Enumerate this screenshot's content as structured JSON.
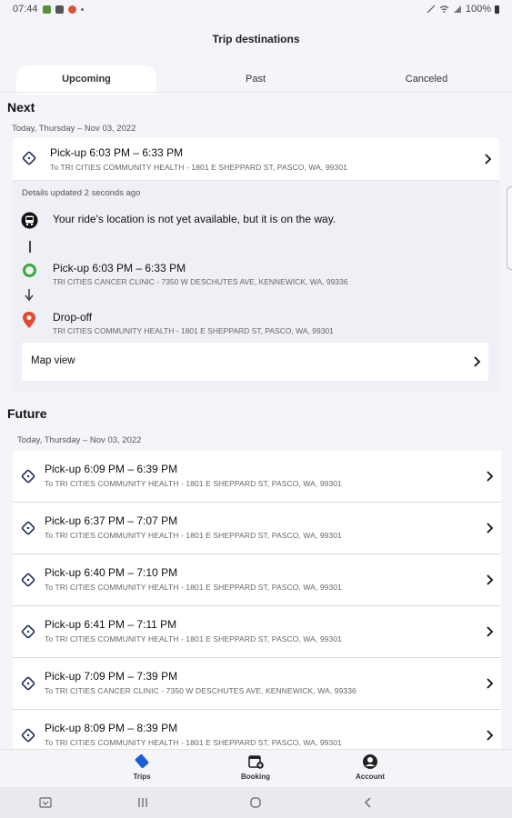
{
  "status": {
    "time": "07:44",
    "battery": "100%"
  },
  "header": {
    "title": "Trip destinations"
  },
  "tabs": [
    {
      "label": "Upcoming",
      "active": true
    },
    {
      "label": "Past",
      "active": false
    },
    {
      "label": "Canceled",
      "active": false
    }
  ],
  "next": {
    "heading": "Next",
    "date": "Today, Thursday – Nov 03, 2022",
    "trip": {
      "title": "Pick-up 6:03 PM – 6:33 PM",
      "subtitle": "To TRI CITIES COMMUNITY HEALTH - 1801 E SHEPPARD ST, PASCO, WA, 99301"
    },
    "details": {
      "updated": "Details updated 2 seconds ago",
      "message": "Your ride's location is not yet available, but it is on the way.",
      "pickup_title": "Pick-up 6:03 PM – 6:33 PM",
      "pickup_address": "TRI CITIES CANCER CLINIC - 7350 W DESCHUTES AVE, KENNEWICK, WA, 99336",
      "dropoff_title": "Drop-off",
      "dropoff_address": "TRI CITIES COMMUNITY HEALTH - 1801 E SHEPPARD ST, PASCO, WA, 99301",
      "map_view": "Map view"
    }
  },
  "future": {
    "heading": "Future",
    "date": "Today, Thursday – Nov 03, 2022",
    "trips": [
      {
        "title": "Pick-up 6:09 PM – 6:39 PM",
        "subtitle": "To TRI CITIES COMMUNITY HEALTH - 1801 E SHEPPARD ST, PASCO, WA, 99301"
      },
      {
        "title": "Pick-up 6:37 PM – 7:07 PM",
        "subtitle": "To TRI CITIES COMMUNITY HEALTH - 1801 E SHEPPARD ST, PASCO, WA, 99301"
      },
      {
        "title": "Pick-up 6:40 PM – 7:10 PM",
        "subtitle": "To TRI CITIES COMMUNITY HEALTH - 1801 E SHEPPARD ST, PASCO, WA, 99301"
      },
      {
        "title": "Pick-up 6:41 PM – 7:11 PM",
        "subtitle": "To TRI CITIES COMMUNITY HEALTH - 1801 E SHEPPARD ST, PASCO, WA, 99301"
      },
      {
        "title": "Pick-up 7:09 PM – 7:39 PM",
        "subtitle": "To TRI CITIES CANCER CLINIC - 7350 W DESCHUTES AVE, KENNEWICK, WA, 99336"
      },
      {
        "title": "Pick-up 8:09 PM – 8:39 PM",
        "subtitle": "To TRI CITIES COMMUNITY HEALTH - 1801 E SHEPPARD ST, PASCO, WA, 99301"
      }
    ]
  },
  "bottom_nav": [
    {
      "label": "Trips",
      "icon": "ticket-icon",
      "active": true
    },
    {
      "label": "Booking",
      "icon": "calendar-add-icon",
      "active": false
    },
    {
      "label": "Account",
      "icon": "account-icon",
      "active": false
    }
  ],
  "colors": {
    "accent": "#1a5fd6",
    "pickup": "#3aa83a",
    "dropoff": "#e2492f",
    "background": "#f4f5f9"
  }
}
